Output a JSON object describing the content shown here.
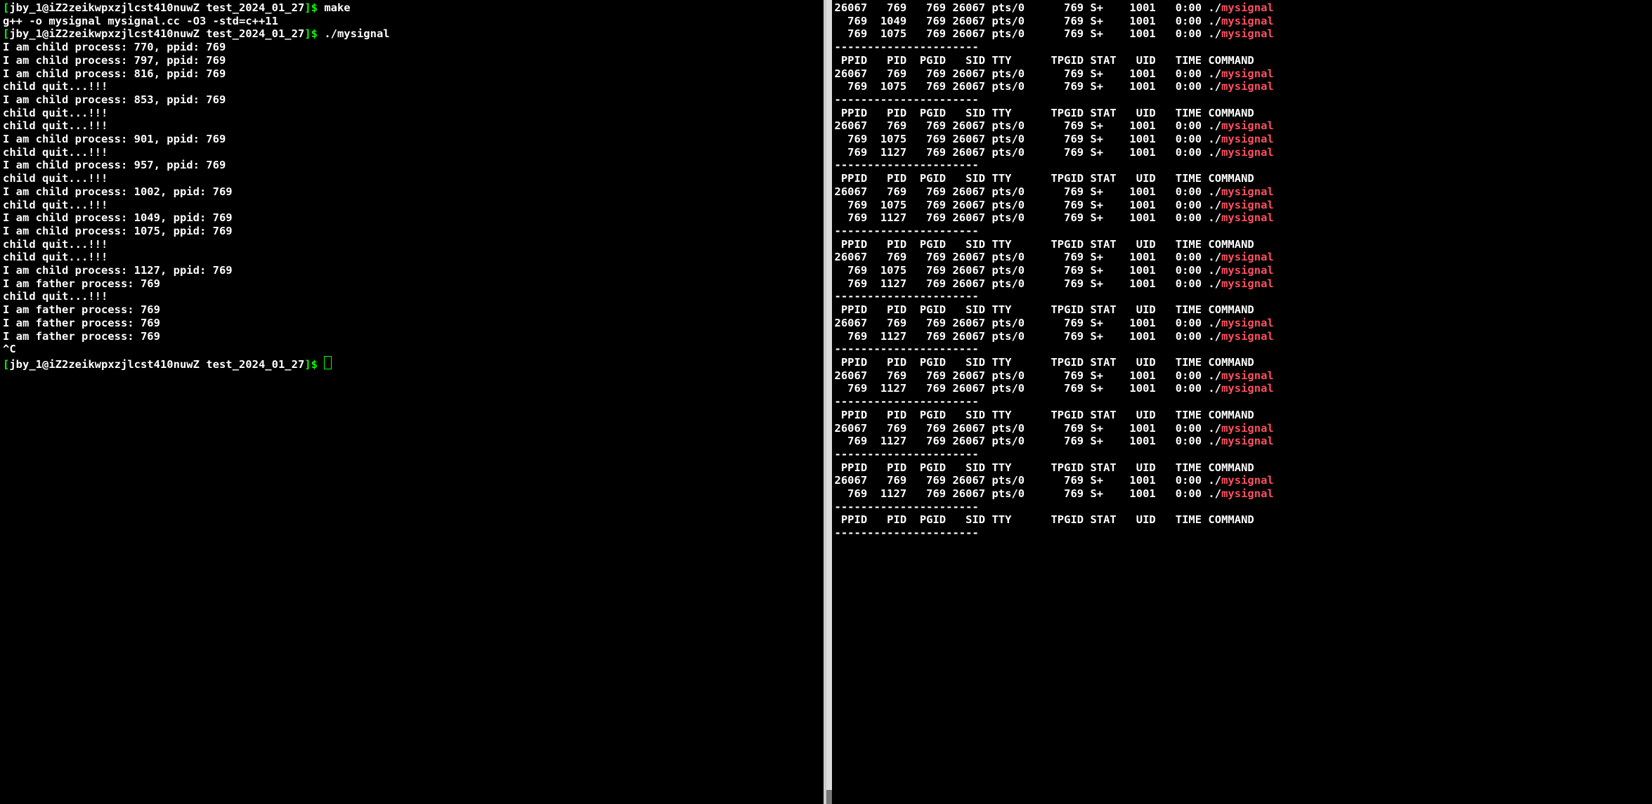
{
  "left": {
    "prompt_user_host": "jby_1@iZ2zeikwpxzjlcst410nuwZ",
    "prompt_dir": "test_2024_01_27",
    "cmd1": "make",
    "line_gpp": "g++ -o mysignal mysignal.cc -O3 -std=c++11",
    "cmd2": "./mysignal",
    "body": [
      "I am child process: 770, ppid: 769",
      "I am child process: 797, ppid: 769",
      "I am child process: 816, ppid: 769",
      "child quit...!!!",
      "I am child process: 853, ppid: 769",
      "child quit...!!!",
      "child quit...!!!",
      "I am child process: 901, ppid: 769",
      "child quit...!!!",
      "I am child process: 957, ppid: 769",
      "child quit...!!!",
      "I am child process: 1002, ppid: 769",
      "child quit...!!!",
      "I am child process: 1049, ppid: 769",
      "I am child process: 1075, ppid: 769",
      "child quit...!!!",
      "child quit...!!!",
      "I am child process: 1127, ppid: 769",
      "I am father process: 769",
      "child quit...!!!",
      "I am father process: 769",
      "I am father process: 769",
      "I am father process: 769",
      "^C"
    ]
  },
  "right": {
    "dashes": "----------------------",
    "header": " PPID   PID  PGID   SID TTY      TPGID STAT   UID   TIME COMMAND",
    "cmd_prefix": "./",
    "cmd_name": "mysignal",
    "top_rows": [
      "26067   769   769 26067 pts/0      769 S+    1001   0:00 ",
      "  769  1049   769 26067 pts/0      769 S+    1001   0:00 ",
      "  769  1075   769 26067 pts/0      769 S+    1001   0:00 "
    ],
    "blocks": [
      [
        "26067   769   769 26067 pts/0      769 S+    1001   0:00 ",
        "  769  1075   769 26067 pts/0      769 S+    1001   0:00 "
      ],
      [
        "26067   769   769 26067 pts/0      769 S+    1001   0:00 ",
        "  769  1075   769 26067 pts/0      769 S+    1001   0:00 ",
        "  769  1127   769 26067 pts/0      769 S+    1001   0:00 "
      ],
      [
        "26067   769   769 26067 pts/0      769 S+    1001   0:00 ",
        "  769  1075   769 26067 pts/0      769 S+    1001   0:00 ",
        "  769  1127   769 26067 pts/0      769 S+    1001   0:00 "
      ],
      [
        "26067   769   769 26067 pts/0      769 S+    1001   0:00 ",
        "  769  1075   769 26067 pts/0      769 S+    1001   0:00 ",
        "  769  1127   769 26067 pts/0      769 S+    1001   0:00 "
      ],
      [
        "26067   769   769 26067 pts/0      769 S+    1001   0:00 ",
        "  769  1127   769 26067 pts/0      769 S+    1001   0:00 "
      ],
      [
        "26067   769   769 26067 pts/0      769 S+    1001   0:00 ",
        "  769  1127   769 26067 pts/0      769 S+    1001   0:00 "
      ],
      [
        "26067   769   769 26067 pts/0      769 S+    1001   0:00 ",
        "  769  1127   769 26067 pts/0      769 S+    1001   0:00 "
      ],
      [
        "26067   769   769 26067 pts/0      769 S+    1001   0:00 ",
        "  769  1127   769 26067 pts/0      769 S+    1001   0:00 "
      ]
    ],
    "trailing_header_only": true
  }
}
